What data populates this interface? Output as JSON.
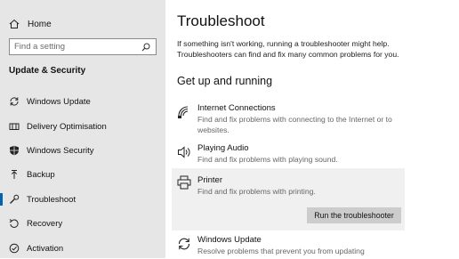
{
  "sidebar": {
    "home": "Home",
    "search": {
      "placeholder": "Find a setting"
    },
    "section": "Update & Security",
    "items": [
      {
        "label": "Windows Update",
        "icon": "refresh-icon"
      },
      {
        "label": "Delivery Optimisation",
        "icon": "delivery-icon"
      },
      {
        "label": "Windows Security",
        "icon": "shield-icon"
      },
      {
        "label": "Backup",
        "icon": "backup-arrow-icon"
      },
      {
        "label": "Troubleshoot",
        "icon": "wrench-icon",
        "selected": true
      },
      {
        "label": "Recovery",
        "icon": "recovery-icon"
      },
      {
        "label": "Activation",
        "icon": "activation-check-icon"
      }
    ]
  },
  "main": {
    "title": "Troubleshoot",
    "intro": "If something isn't working, running a troubleshooter might help. Troubleshooters can find and fix many common problems for you.",
    "section": "Get up and running",
    "troubleshooters": [
      {
        "title": "Internet Connections",
        "description": "Find and fix problems with connecting to the Internet or to websites.",
        "icon": "wifi-icon"
      },
      {
        "title": "Playing Audio",
        "description": "Find and fix problems with playing sound.",
        "icon": "speaker-icon"
      },
      {
        "title": "Printer",
        "description": "Find and fix problems with printing.",
        "icon": "printer-icon",
        "expanded": true,
        "button": "Run the troubleshooter"
      },
      {
        "title": "Windows Update",
        "description": "Resolve problems that prevent you from updating",
        "icon": "refresh-icon"
      }
    ]
  },
  "colors": {
    "sidebar_bg": "#e6e6e6",
    "accent": "#0063b1",
    "button_bg": "#cccccc",
    "expanded_bg": "#f0f0f0"
  }
}
